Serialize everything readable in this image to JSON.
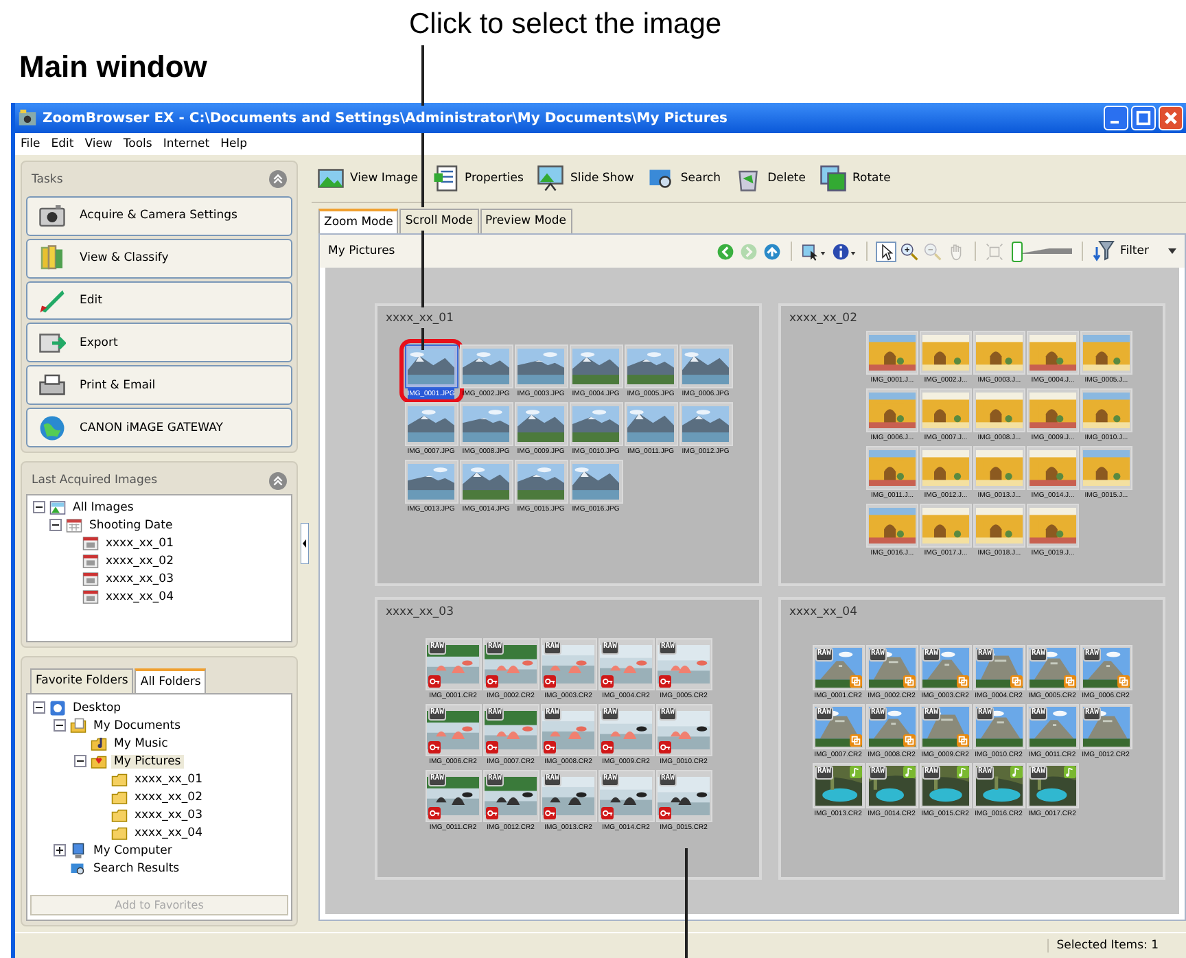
{
  "annotations": {
    "caption": "Click to select the image",
    "heading": "Main window"
  },
  "window": {
    "title": "ZoomBrowser EX  -  C:\\Documents and Settings\\Administrator\\My Documents\\My Pictures"
  },
  "menu": [
    "File",
    "Edit",
    "View",
    "Tools",
    "Internet",
    "Help"
  ],
  "tasks": {
    "title": "Tasks",
    "items": [
      {
        "kind": "camera",
        "label": "Acquire & Camera Settings"
      },
      {
        "kind": "books",
        "label": "View & Classify"
      },
      {
        "kind": "edit",
        "label": "Edit"
      },
      {
        "kind": "export",
        "label": "Export"
      },
      {
        "kind": "print",
        "label": "Print & Email"
      },
      {
        "kind": "globe",
        "label": "CANON iMAGE GATEWAY"
      }
    ]
  },
  "last_acquired": {
    "title": "Last Acquired Images",
    "tree": [
      {
        "kind": "images",
        "label": "All Images",
        "expanded": true,
        "selected": false,
        "children": [
          {
            "kind": "calendar",
            "label": "Shooting Date",
            "expanded": true,
            "selected": false,
            "children": [
              {
                "kind": "date",
                "label": "xxxx_xx_01",
                "selected": false
              },
              {
                "kind": "date",
                "label": "xxxx_xx_02",
                "selected": false
              },
              {
                "kind": "date",
                "label": "xxxx_xx_03",
                "selected": false
              },
              {
                "kind": "date",
                "label": "xxxx_xx_04",
                "selected": false
              }
            ]
          }
        ]
      }
    ]
  },
  "folders": {
    "tabs": [
      {
        "label": "Favorite Folders",
        "selected": false
      },
      {
        "label": "All Folders",
        "selected": true
      }
    ],
    "tree": [
      {
        "kind": "desktop",
        "label": "Desktop",
        "expanded": true,
        "selected": false,
        "children": [
          {
            "kind": "documents",
            "label": "My Documents",
            "expanded": true,
            "selected": false,
            "children": [
              {
                "kind": "music",
                "label": "My Music",
                "selected": false
              },
              {
                "kind": "pictures",
                "label": "My Pictures",
                "expanded": true,
                "selected": true,
                "children": [
                  {
                    "kind": "folder",
                    "label": "xxxx_xx_01",
                    "selected": false
                  },
                  {
                    "kind": "folder",
                    "label": "xxxx_xx_02",
                    "selected": false
                  },
                  {
                    "kind": "folder",
                    "label": "xxxx_xx_03",
                    "selected": false
                  },
                  {
                    "kind": "folder",
                    "label": "xxxx_xx_04",
                    "selected": false
                  }
                ]
              }
            ]
          },
          {
            "kind": "computer",
            "label": "My Computer",
            "expanded": false,
            "selected": false
          },
          {
            "kind": "search",
            "label": "Search Results",
            "selected": false
          }
        ]
      }
    ],
    "add_button": {
      "label": "Add to Favorites",
      "disabled": true
    }
  },
  "toolbar": [
    {
      "kind": "view",
      "label": "View Image"
    },
    {
      "kind": "properties",
      "label": "Properties"
    },
    {
      "kind": "slideshow",
      "label": "Slide Show"
    },
    {
      "kind": "search",
      "label": "Search"
    },
    {
      "kind": "delete",
      "label": "Delete"
    },
    {
      "kind": "rotate",
      "label": "Rotate"
    }
  ],
  "mode_tabs": [
    {
      "label": "Zoom Mode",
      "selected": true
    },
    {
      "label": "Scroll Mode",
      "selected": false
    },
    {
      "label": "Preview Mode",
      "selected": false
    }
  ],
  "location": "My Pictures",
  "tools": [
    {
      "kind": "back",
      "disabled": false,
      "selected": false
    },
    {
      "kind": "forward",
      "disabled": true,
      "selected": false
    },
    {
      "kind": "up",
      "disabled": false,
      "selected": false
    },
    {
      "kind": "sep"
    },
    {
      "kind": "display",
      "disabled": false,
      "selected": false
    },
    {
      "kind": "info",
      "disabled": false,
      "selected": false
    },
    {
      "kind": "sep"
    },
    {
      "kind": "pointer",
      "disabled": false,
      "selected": true
    },
    {
      "kind": "zoom-in",
      "disabled": false,
      "selected": false
    },
    {
      "kind": "zoom-out",
      "disabled": true,
      "selected": false
    },
    {
      "kind": "hand",
      "disabled": true,
      "selected": false
    },
    {
      "kind": "sep"
    },
    {
      "kind": "fit",
      "disabled": true,
      "selected": false
    }
  ],
  "zoom_slider": {
    "level": 0.05
  },
  "filter": {
    "label": "Filter"
  },
  "groups": [
    {
      "title": "xxxx_xx_01",
      "thumbs": [
        {
          "label": "IMG_0001.JPG",
          "selected": true
        },
        {
          "label": "IMG_0002.JPG",
          "selected": false
        },
        {
          "label": "IMG_0003.JPG",
          "selected": false
        },
        {
          "label": "IMG_0004.JPG",
          "selected": false
        },
        {
          "label": "IMG_0005.JPG",
          "selected": false
        },
        {
          "label": "IMG_0006.JPG",
          "selected": false
        },
        {
          "label": "IMG_0007.JPG",
          "selected": false
        },
        {
          "label": "IMG_0008.JPG",
          "selected": false
        },
        {
          "label": "IMG_0009.JPG",
          "selected": false
        },
        {
          "label": "IMG_0010.JPG",
          "selected": false
        },
        {
          "label": "IMG_0011.JPG",
          "selected": false
        },
        {
          "label": "IMG_0012.JPG",
          "selected": false
        },
        {
          "label": "IMG_0013.JPG",
          "selected": false
        },
        {
          "label": "IMG_0014.JPG",
          "selected": false
        },
        {
          "label": "IMG_0015.JPG",
          "selected": false
        },
        {
          "label": "IMG_0016.JPG",
          "selected": false
        }
      ]
    },
    {
      "title": "xxxx_xx_02",
      "thumbs": [
        {
          "label": "IMG_0001.J...",
          "selected": false
        },
        {
          "label": "IMG_0002.J...",
          "selected": false
        },
        {
          "label": "IMG_0003.J...",
          "selected": false
        },
        {
          "label": "IMG_0004.J...",
          "selected": false
        },
        {
          "label": "IMG_0005.J...",
          "selected": false
        },
        {
          "label": "IMG_0006.J...",
          "selected": false
        },
        {
          "label": "IMG_0007.J...",
          "selected": false
        },
        {
          "label": "IMG_0008.J...",
          "selected": false
        },
        {
          "label": "IMG_0009.J...",
          "selected": false
        },
        {
          "label": "IMG_0010.J...",
          "selected": false
        },
        {
          "label": "IMG_0011.J...",
          "selected": false
        },
        {
          "label": "IMG_0012.J...",
          "selected": false
        },
        {
          "label": "IMG_0013.J...",
          "selected": false
        },
        {
          "label": "IMG_0014.J...",
          "selected": false
        },
        {
          "label": "IMG_0015.J...",
          "selected": false
        },
        {
          "label": "IMG_0016.J...",
          "selected": false
        },
        {
          "label": "IMG_0017.J...",
          "selected": false
        },
        {
          "label": "IMG_0018.J...",
          "selected": false
        },
        {
          "label": "IMG_0019.J...",
          "selected": false
        }
      ]
    },
    {
      "title": "xxxx_xx_03",
      "thumbs": [
        {
          "label": "IMG_0001.CR2",
          "selected": false,
          "badge": "RAW",
          "protected": true
        },
        {
          "label": "IMG_0002.CR2",
          "selected": false,
          "badge": "RAW",
          "protected": true
        },
        {
          "label": "IMG_0003.CR2",
          "selected": false,
          "badge": "RAW",
          "protected": true
        },
        {
          "label": "IMG_0004.CR2",
          "selected": false,
          "badge": "RAW",
          "protected": true
        },
        {
          "label": "IMG_0005.CR2",
          "selected": false,
          "badge": "RAW",
          "protected": true
        },
        {
          "label": "IMG_0006.CR2",
          "selected": false,
          "badge": "RAW",
          "protected": true
        },
        {
          "label": "IMG_0007.CR2",
          "selected": false,
          "badge": "RAW",
          "protected": true
        },
        {
          "label": "IMG_0008.CR2",
          "selected": false,
          "badge": "RAW",
          "protected": true
        },
        {
          "label": "IMG_0009.CR2",
          "selected": false,
          "badge": "RAW",
          "protected": true
        },
        {
          "label": "IMG_0010.CR2",
          "selected": false,
          "badge": "RAW",
          "protected": true
        },
        {
          "label": "IMG_0011.CR2",
          "selected": false,
          "badge": "RAW",
          "protected": true
        },
        {
          "label": "IMG_0012.CR2",
          "selected": false,
          "badge": "RAW",
          "protected": true
        },
        {
          "label": "IMG_0013.CR2",
          "selected": false,
          "badge": "RAW",
          "protected": true
        },
        {
          "label": "IMG_0014.CR2",
          "selected": false,
          "badge": "RAW",
          "protected": true
        },
        {
          "label": "IMG_0015.CR2",
          "selected": false,
          "badge": "RAW",
          "protected": true
        }
      ]
    },
    {
      "title": "xxxx_xx_04",
      "thumbs": [
        {
          "label": "IMG_0001.CR2",
          "selected": false,
          "badge": "RAW",
          "stitched": true,
          "has_sound": false
        },
        {
          "label": "IMG_0002.CR2",
          "selected": false,
          "badge": "RAW",
          "stitched": true,
          "has_sound": false
        },
        {
          "label": "IMG_0003.CR2",
          "selected": false,
          "badge": "RAW",
          "stitched": true,
          "has_sound": false
        },
        {
          "label": "IMG_0004.CR2",
          "selected": false,
          "badge": "RAW",
          "stitched": true,
          "has_sound": false
        },
        {
          "label": "IMG_0005.CR2",
          "selected": false,
          "badge": "RAW",
          "stitched": true,
          "has_sound": false
        },
        {
          "label": "IMG_0006.CR2",
          "selected": false,
          "badge": "RAW",
          "stitched": true,
          "has_sound": false
        },
        {
          "label": "IMG_0007.CR2",
          "selected": false,
          "badge": "RAW",
          "stitched": true,
          "has_sound": false
        },
        {
          "label": "IMG_0008.CR2",
          "selected": false,
          "badge": "RAW",
          "stitched": true,
          "has_sound": false
        },
        {
          "label": "IMG_0009.CR2",
          "selected": false,
          "badge": "RAW",
          "stitched": true,
          "has_sound": false
        },
        {
          "label": "IMG_0010.CR2",
          "selected": false,
          "badge": "RAW",
          "stitched": false,
          "has_sound": false
        },
        {
          "label": "IMG_0011.CR2",
          "selected": false,
          "badge": "RAW",
          "stitched": false,
          "has_sound": false
        },
        {
          "label": "IMG_0012.CR2",
          "selected": false,
          "badge": "RAW",
          "stitched": false,
          "has_sound": false
        },
        {
          "label": "IMG_0013.CR2",
          "selected": false,
          "badge": "RAW",
          "stitched": false,
          "has_sound": true
        },
        {
          "label": "IMG_0014.CR2",
          "selected": false,
          "badge": "RAW",
          "stitched": false,
          "has_sound": true
        },
        {
          "label": "IMG_0015.CR2",
          "selected": false,
          "badge": "RAW",
          "stitched": false,
          "has_sound": true
        },
        {
          "label": "IMG_0016.CR2",
          "selected": false,
          "badge": "RAW",
          "stitched": false,
          "has_sound": true
        },
        {
          "label": "IMG_0017.CR2",
          "selected": false,
          "badge": "RAW",
          "stitched": false,
          "has_sound": true
        }
      ]
    }
  ],
  "status_bar": {
    "selection": "Selected Items: 1"
  }
}
